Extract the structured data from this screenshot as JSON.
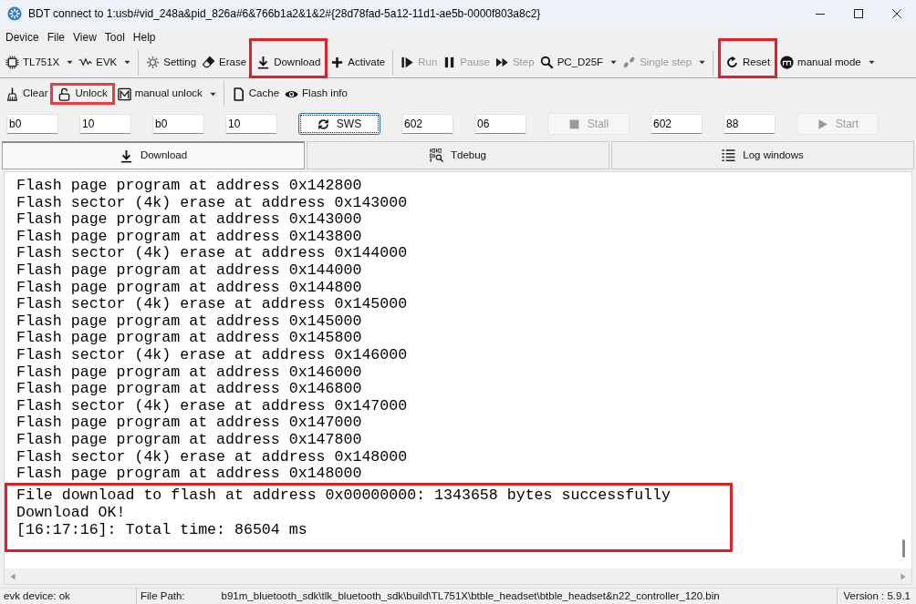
{
  "window": {
    "title": "BDT connect to 1:usb#vid_248a&pid_826a#6&766b1a2&1&2#{28d78fad-5a12-11d1-ae5b-0000f803a8c2}"
  },
  "menu": [
    "Device",
    "File",
    "View",
    "Tool",
    "Help"
  ],
  "toolbar_1": {
    "groups": [
      {
        "items": [
          {
            "label": "TL751X",
            "dropdown": true,
            "disabled": false,
            "highlighted": false
          },
          {
            "label": "EVK",
            "dropdown": true,
            "disabled": false,
            "highlighted": false
          }
        ]
      },
      {
        "items": [
          {
            "label": "Setting",
            "dropdown": false,
            "disabled": false,
            "highlighted": false
          },
          {
            "label": "Erase",
            "dropdown": false,
            "disabled": false,
            "highlighted": false
          },
          {
            "label": "Download",
            "dropdown": false,
            "disabled": false,
            "highlighted": true
          },
          {
            "label": "Activate",
            "dropdown": false,
            "disabled": false,
            "highlighted": false
          }
        ]
      },
      {
        "items": [
          {
            "label": "Run",
            "dropdown": false,
            "disabled": true,
            "highlighted": false
          },
          {
            "label": "Pause",
            "dropdown": false,
            "disabled": true,
            "highlighted": false
          },
          {
            "label": "Step",
            "dropdown": false,
            "disabled": true,
            "highlighted": false
          },
          {
            "label": "PC_D25F",
            "dropdown": true,
            "disabled": false,
            "highlighted": false
          },
          {
            "label": "Single step",
            "dropdown": true,
            "disabled": true,
            "highlighted": false
          }
        ]
      },
      {
        "items": [
          {
            "label": "Reset",
            "dropdown": false,
            "disabled": false,
            "highlighted": true
          },
          {
            "label": "manual mode",
            "dropdown": true,
            "disabled": false,
            "highlighted": false
          }
        ]
      }
    ]
  },
  "toolbar_2": {
    "groups": [
      {
        "items": [
          {
            "label": "Clear",
            "dropdown": false,
            "disabled": false,
            "highlighted": false
          },
          {
            "label": "Unlock",
            "dropdown": false,
            "disabled": false,
            "highlighted": true
          },
          {
            "label": "manual unlock",
            "dropdown": true,
            "disabled": false,
            "highlighted": false
          }
        ]
      },
      {
        "items": [
          {
            "label": "Cache",
            "dropdown": false,
            "disabled": false,
            "highlighted": false
          },
          {
            "label": "Flash info",
            "dropdown": false,
            "disabled": false,
            "highlighted": false
          }
        ]
      }
    ]
  },
  "register_row": [
    {
      "kind": "field",
      "value": "b0"
    },
    {
      "kind": "field",
      "value": "10"
    },
    {
      "kind": "field",
      "value": "b0"
    },
    {
      "kind": "field",
      "value": "10"
    },
    {
      "kind": "button",
      "label": "SWS",
      "disabled": false,
      "focused": true
    },
    {
      "kind": "field",
      "value": "602"
    },
    {
      "kind": "field",
      "value": "06"
    },
    {
      "kind": "button",
      "label": "Stall",
      "disabled": true,
      "focused": false
    },
    {
      "kind": "field",
      "value": "602"
    },
    {
      "kind": "field",
      "value": "88"
    },
    {
      "kind": "button",
      "label": "Start",
      "disabled": true,
      "focused": false
    }
  ],
  "tabs": [
    {
      "label": "Download",
      "selected": true
    },
    {
      "label": "Tdebug",
      "selected": false
    },
    {
      "label": "Log windows",
      "selected": false
    }
  ],
  "log": {
    "lines": [
      "Flash page program at address 0x142800",
      "Flash sector (4k) erase at address 0x143000",
      "Flash page program at address 0x143000",
      "Flash page program at address 0x143800",
      "Flash sector (4k) erase at address 0x144000",
      "Flash page program at address 0x144000",
      "Flash page program at address 0x144800",
      "Flash sector (4k) erase at address 0x145000",
      "Flash page program at address 0x145000",
      "Flash page program at address 0x145800",
      "Flash sector (4k) erase at address 0x146000",
      "Flash page program at address 0x146000",
      "Flash page program at address 0x146800",
      "Flash sector (4k) erase at address 0x147000",
      "Flash page program at address 0x147000",
      "Flash page program at address 0x147800",
      "Flash sector (4k) erase at address 0x148000",
      "Flash page program at address 0x148000"
    ],
    "result": {
      "highlighted": true,
      "lines": [
        "File download to flash at address 0x00000000: 1343658 bytes successfully",
        "Download OK!",
        "[16:17:16]: Total time: 86504 ms"
      ]
    }
  },
  "status_bar": {
    "device": "evk device: ok",
    "file_path_label": "File Path:",
    "file_path": "b91m_bluetooth_sdk\\tlk_bluetooth_sdk\\build\\TL751X\\btble_headset\\btble_headset&n22_controller_120.bin",
    "version": "Version : 5.9.1"
  }
}
